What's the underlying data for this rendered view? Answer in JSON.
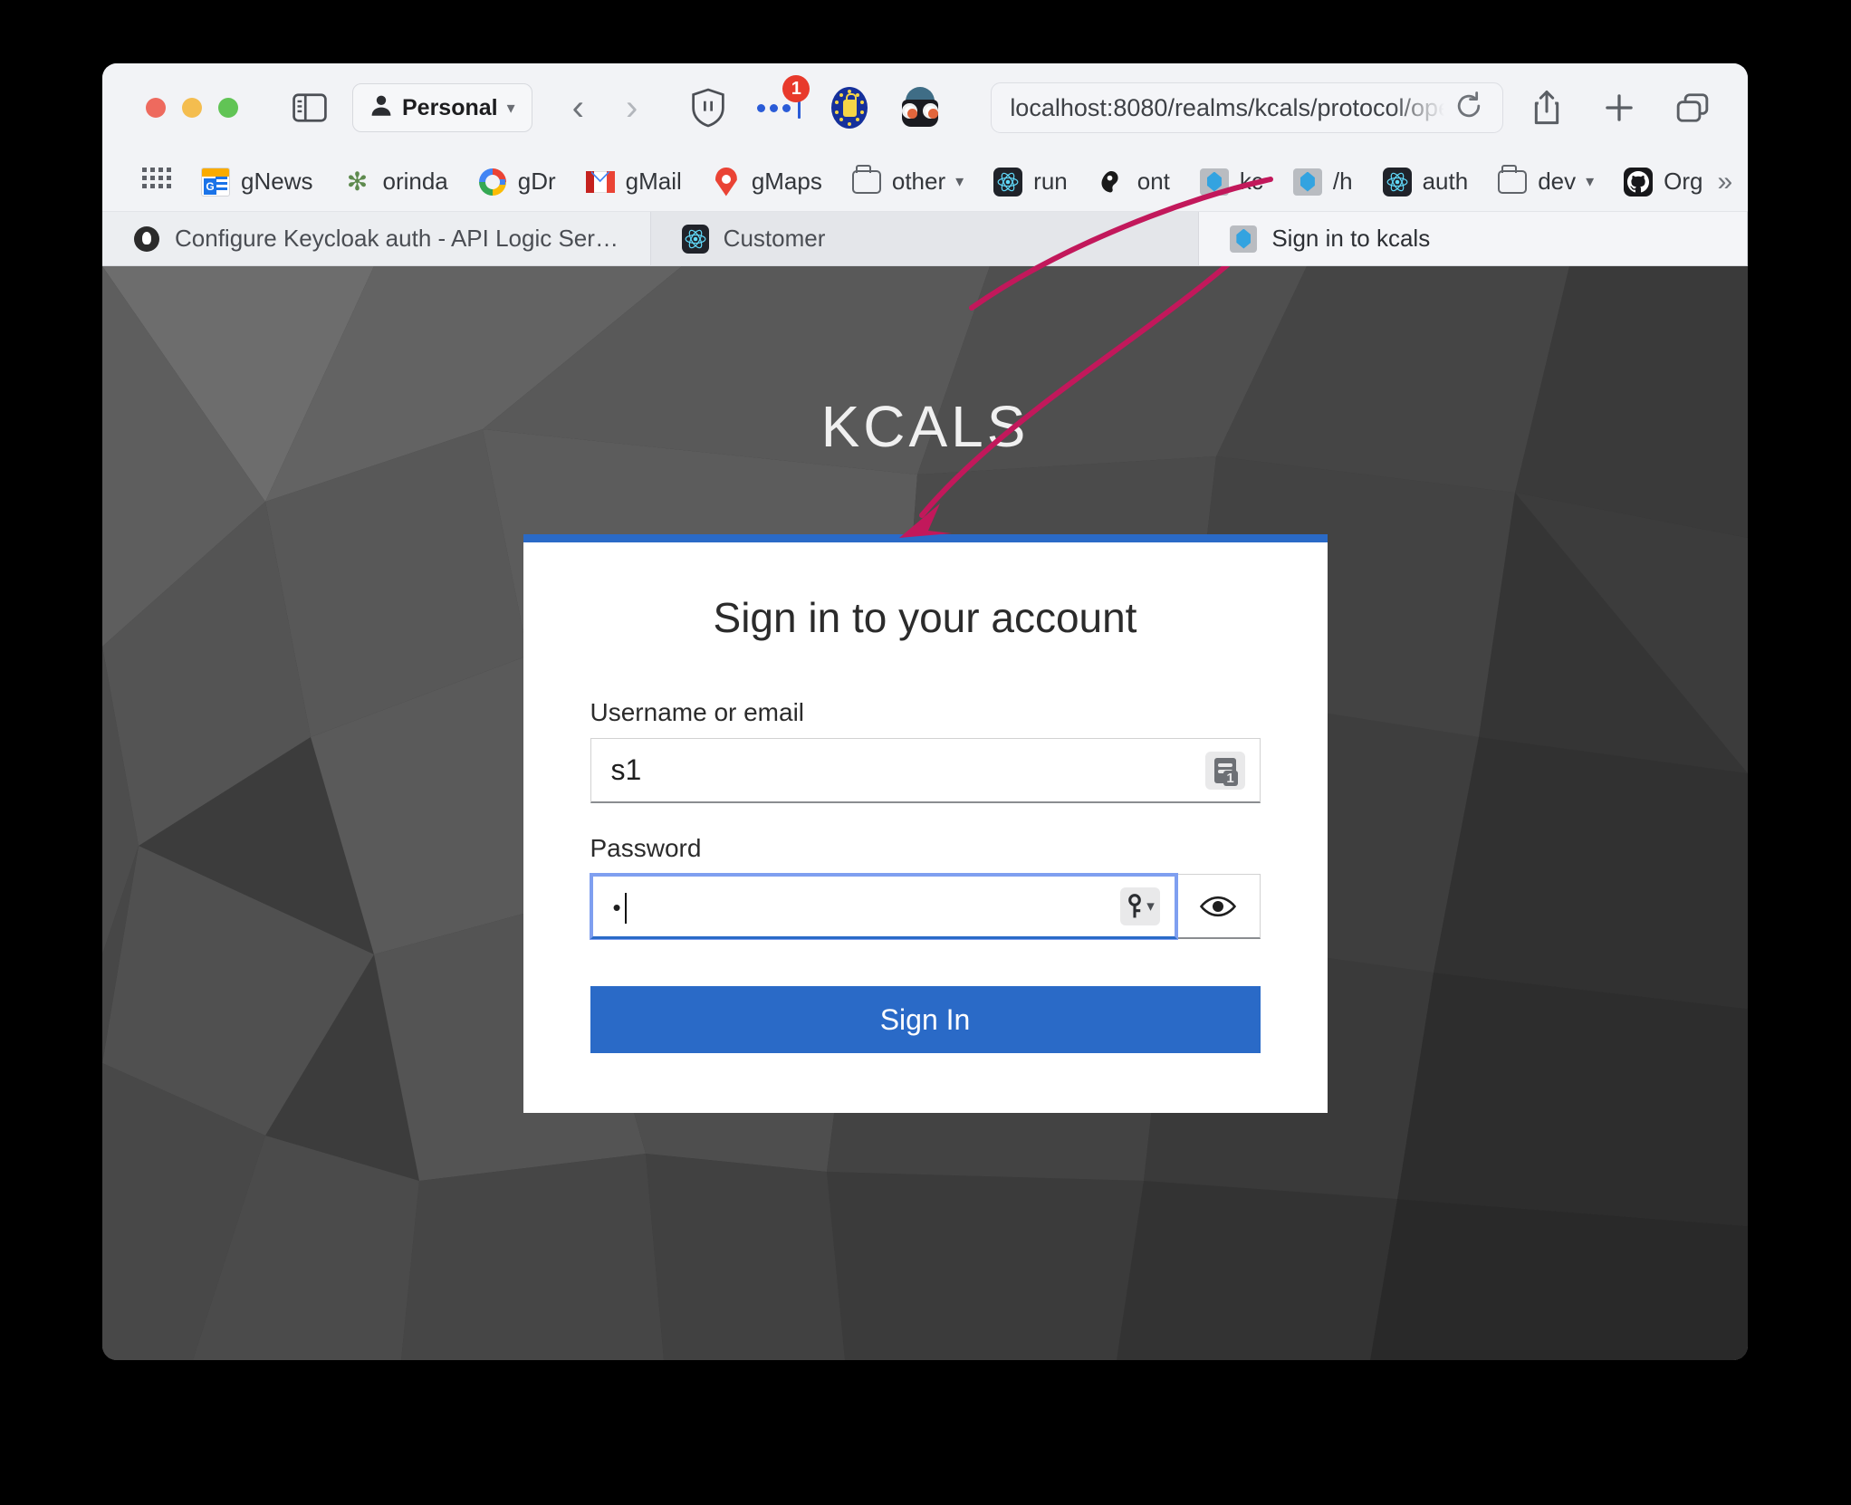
{
  "browser": {
    "profile_label": "Personal",
    "profile_chevron": "chevron-down",
    "back_glyph": "‹",
    "forward_glyph": "›",
    "url": "localhost:8080/realms/kcals/protocol/ope",
    "extension_badge_count": "1",
    "bookmarks": [
      {
        "label": "gNews",
        "icon": "google-news-icon"
      },
      {
        "label": "orinda",
        "icon": "orinda-icon"
      },
      {
        "label": "gDr",
        "icon": "google-drive-icon"
      },
      {
        "label": "gMail",
        "icon": "gmail-icon"
      },
      {
        "label": "gMaps",
        "icon": "google-maps-icon"
      },
      {
        "label": "other",
        "icon": "folder-icon",
        "chevron": "⌄"
      },
      {
        "label": "run",
        "icon": "react-icon"
      },
      {
        "label": "ont",
        "icon": "ont-icon"
      },
      {
        "label": "kc",
        "icon": "keycloak-icon"
      },
      {
        "label": "/h",
        "icon": "keycloak-icon"
      },
      {
        "label": "auth",
        "icon": "react-icon"
      },
      {
        "label": "dev",
        "icon": "folder-icon",
        "chevron": "⌄"
      },
      {
        "label": "Org",
        "icon": "github-icon"
      }
    ],
    "bookmarks_overflow": "»",
    "tabs": [
      {
        "title": "Configure Keycloak auth - API Logic Server",
        "favicon": "alsk-icon",
        "state": "inactive"
      },
      {
        "title": "Customer",
        "favicon": "react-icon",
        "state": "inactive"
      },
      {
        "title": "Sign in to kcals",
        "favicon": "keycloak-icon",
        "state": "active"
      }
    ]
  },
  "page": {
    "brand": "KCALS",
    "card": {
      "title": "Sign in to your account",
      "username": {
        "label": "Username or email",
        "value": "s1",
        "autofill_icon": "password-manager-card-icon",
        "autofill_badge": "1"
      },
      "password": {
        "label": "Password",
        "value": "•",
        "autofill_icon": "password-manager-key-icon",
        "toggle_icon": "eye-icon",
        "focused": true
      },
      "submit_label": "Sign In"
    },
    "colors": {
      "accent": "#2a6ac7",
      "card_top_border": "#2a6ac7",
      "background": "#3a3a3a",
      "annotation": "#c2185b"
    },
    "annotation": {
      "type": "hand-drawn-arrow",
      "from": "tab-sign-in-to-kcals",
      "to": "brand-kcals"
    }
  }
}
